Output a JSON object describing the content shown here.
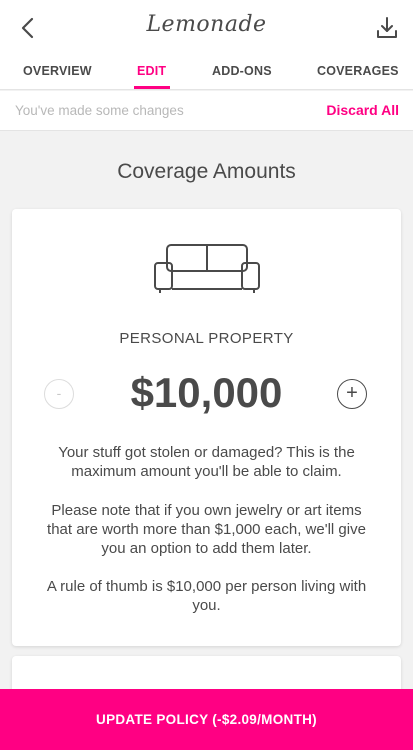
{
  "header": {
    "logo": "Lemonade",
    "back_icon": "chevron-left-icon",
    "download_icon": "download-icon"
  },
  "tabs": [
    {
      "label": "OVERVIEW",
      "active": false
    },
    {
      "label": "EDIT",
      "active": true
    },
    {
      "label": "ADD-ONS",
      "active": false
    },
    {
      "label": "COVERAGES",
      "active": false
    }
  ],
  "changes_bar": {
    "message": "You've made some changes",
    "discard_label": "Discard All"
  },
  "section_title": "Coverage Amounts",
  "coverage_card": {
    "icon": "sofa-icon",
    "label": "PERSONAL PROPERTY",
    "amount": "$10,000",
    "decrease_label": "-",
    "increase_label": "+",
    "paragraphs": [
      "Your stuff got stolen or damaged? This is the maximum amount you'll be able to claim.",
      "Please note that if you own jewelry or art items that are worth more than $1,000 each, we'll give you an option to add them later.",
      "A rule of thumb is $10,000 per person living with you."
    ]
  },
  "cta": {
    "label": "UPDATE POLICY (-$2.09/MONTH)"
  },
  "colors": {
    "accent": "#ff0083",
    "text": "#4a4a4a",
    "muted": "#b8b8b8",
    "background": "#f2f2f2"
  }
}
